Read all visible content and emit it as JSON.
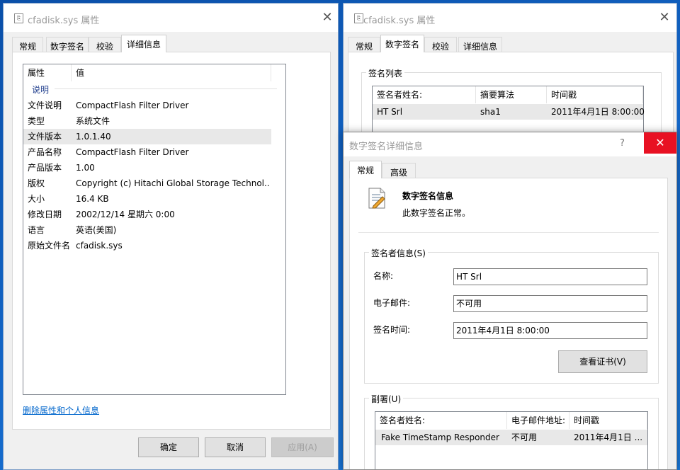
{
  "left": {
    "title": "cfadisk.sys 属性",
    "tabs": [
      "常规",
      "数字签名",
      "校验",
      "详细信息"
    ],
    "col_property": "属性",
    "col_value": "值",
    "section": "说明",
    "rows": [
      {
        "k": "文件说明",
        "v": "CompactFlash Filter Driver"
      },
      {
        "k": "类型",
        "v": "系统文件"
      },
      {
        "k": "文件版本",
        "v": "1.0.1.40"
      },
      {
        "k": "产品名称",
        "v": "CompactFlash Filter Driver"
      },
      {
        "k": "产品版本",
        "v": "1.00"
      },
      {
        "k": "版权",
        "v": "Copyright (c) Hitachi Global Storage Technol..."
      },
      {
        "k": "大小",
        "v": "16.4 KB"
      },
      {
        "k": "修改日期",
        "v": "2002/12/14 星期六 0:00"
      },
      {
        "k": "语言",
        "v": "英语(美国)"
      },
      {
        "k": "原始文件名",
        "v": "cfadisk.sys"
      }
    ],
    "link": "删除属性和个人信息",
    "ok": "确定",
    "cancel": "取消",
    "apply": "应用(A)"
  },
  "right": {
    "title": "cfadisk.sys 属性",
    "tabs": [
      "常规",
      "数字签名",
      "校验",
      "详细信息"
    ],
    "group": "签名列表",
    "cols": [
      "签名者姓名:",
      "摘要算法",
      "时间戳"
    ],
    "row": [
      "HT Srl",
      "sha1",
      "2011年4月1日 8:00:00"
    ]
  },
  "dialog": {
    "title": "数字签名详细信息",
    "help": "?",
    "tabs": [
      "常规",
      "高级"
    ],
    "heading": "数字签名信息",
    "status": "此数字签名正常。",
    "signer_group": "签名者信息(S)",
    "name_label": "名称:",
    "name_value": "HT Srl",
    "email_label": "电子邮件:",
    "email_value": "不可用",
    "time_label": "签名时间:",
    "time_value": "2011年4月1日 8:00:00",
    "view_cert": "查看证书(V)",
    "counter_group": "副署(U)",
    "counter_cols": [
      "签名者姓名:",
      "电子邮件地址:",
      "时间戳"
    ],
    "counter_row": [
      "Fake TimeStamp Responder",
      "不可用",
      "2011年4月1日 ..."
    ]
  }
}
